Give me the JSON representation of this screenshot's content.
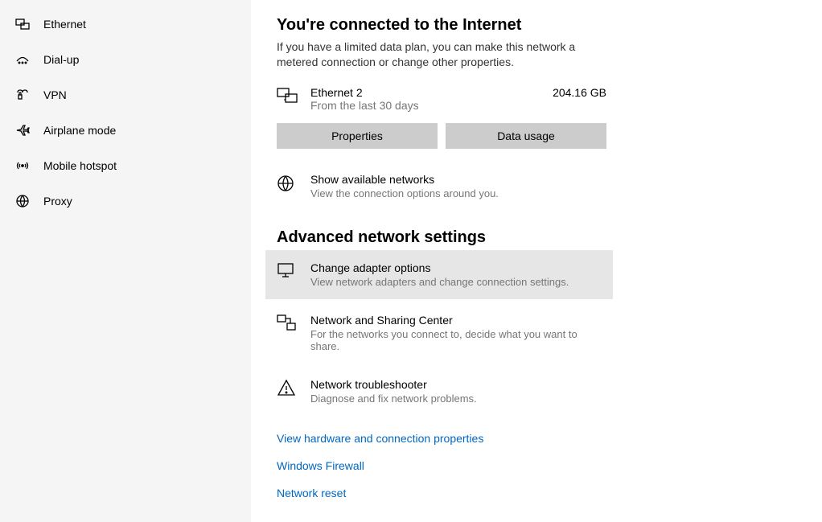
{
  "sidebar": {
    "items": [
      {
        "label": "Ethernet"
      },
      {
        "label": "Dial-up"
      },
      {
        "label": "VPN"
      },
      {
        "label": "Airplane mode"
      },
      {
        "label": "Mobile hotspot"
      },
      {
        "label": "Proxy"
      }
    ]
  },
  "main": {
    "heading": "You're connected to the Internet",
    "subtext": "If you have a limited data plan, you can make this network a metered connection or change other properties.",
    "connection": {
      "name": "Ethernet 2",
      "period": "From the last 30 days",
      "usage": "204.16 GB"
    },
    "buttons": {
      "properties": "Properties",
      "data_usage": "Data usage"
    },
    "available": {
      "title": "Show available networks",
      "desc": "View the connection options around you."
    },
    "advanced_heading": "Advanced network settings",
    "options": [
      {
        "title": "Change adapter options",
        "desc": "View network adapters and change connection settings."
      },
      {
        "title": "Network and Sharing Center",
        "desc": "For the networks you connect to, decide what you want to share."
      },
      {
        "title": "Network troubleshooter",
        "desc": "Diagnose and fix network problems."
      }
    ],
    "links": [
      "View hardware and connection properties",
      "Windows Firewall",
      "Network reset"
    ]
  }
}
